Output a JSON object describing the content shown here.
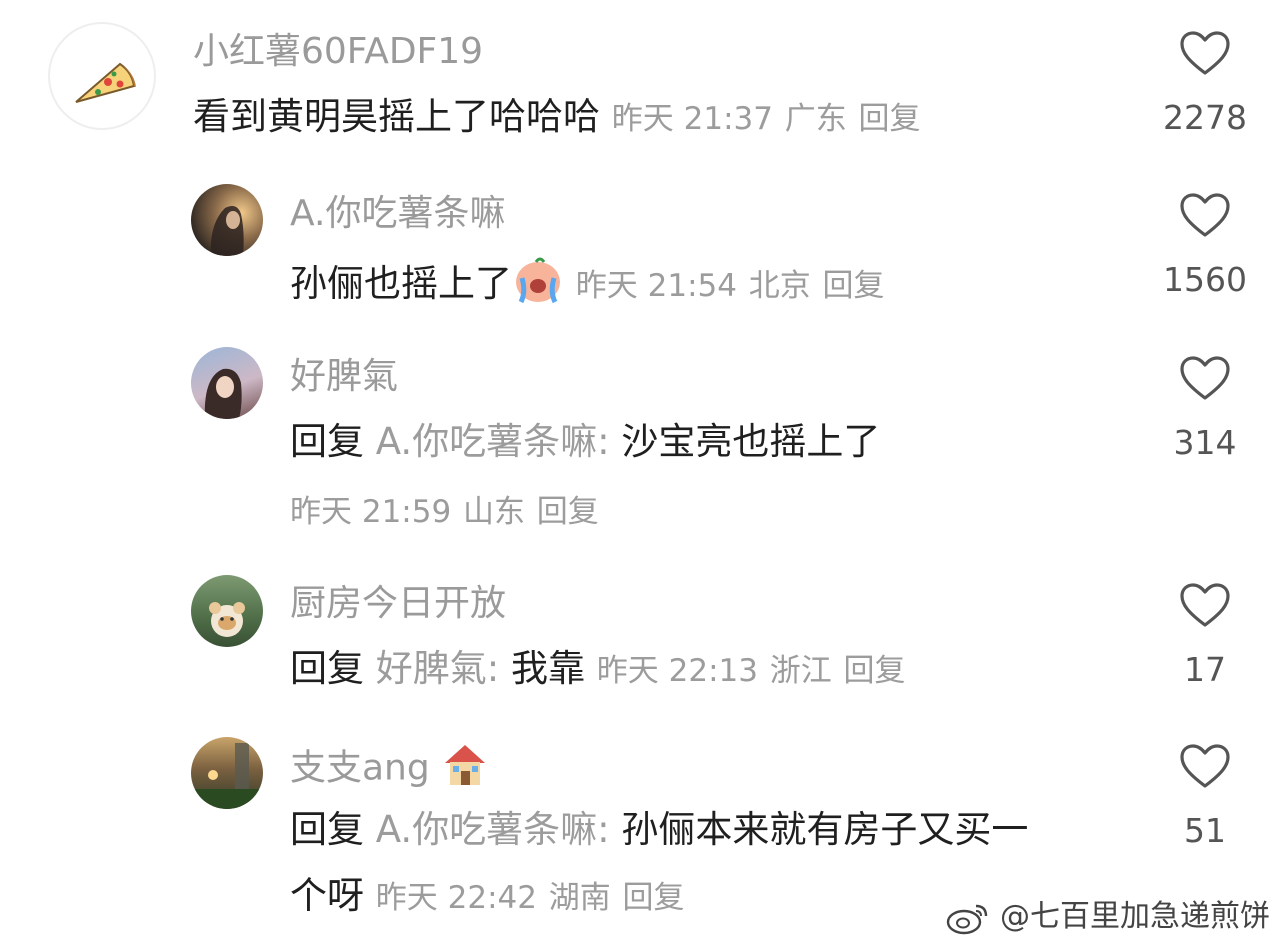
{
  "comments": [
    {
      "username": "小红薯60FADF19",
      "text": "看到黄明昊摇上了哈哈哈",
      "time": "昨天 21:37",
      "location": "广东",
      "reply_label": "回复",
      "likes": "2278",
      "avatar_icon": "pizza-icon"
    },
    {
      "username": "A.你吃薯条嘛",
      "text": "孙俪也摇上了",
      "emoji": "crying-face-emoji",
      "time": "昨天 21:54",
      "location": "北京",
      "reply_label": "回复",
      "likes": "1560"
    },
    {
      "username": "好脾氣",
      "reply_prefix": "回复",
      "reply_to": "A.你吃薯条嘛:",
      "text": "沙宝亮也摇上了",
      "time": "昨天 21:59",
      "location": "山东",
      "reply_label": "回复",
      "likes": "314"
    },
    {
      "username": "厨房今日开放",
      "reply_prefix": "回复",
      "reply_to": "好脾氣:",
      "text": "我靠",
      "time": "昨天 22:13",
      "location": "浙江",
      "reply_label": "回复",
      "likes": "17"
    },
    {
      "username": "支支ang",
      "username_emoji": "house-emoji",
      "reply_prefix": "回复",
      "reply_to": "A.你吃薯条嘛:",
      "text_line1": "孙俪本来就有房子又买一",
      "text_line2": "个呀",
      "time": "昨天 22:42",
      "location": "湖南",
      "reply_label": "回复",
      "likes": "51"
    }
  ],
  "watermark": "@七百里加急递煎饼",
  "watermark_icon": "weibo-icon",
  "like_icon": "heart-outline-icon",
  "colors": {
    "text": "#1f1f1f",
    "muted": "#9c9c9c",
    "icon": "#555555"
  }
}
